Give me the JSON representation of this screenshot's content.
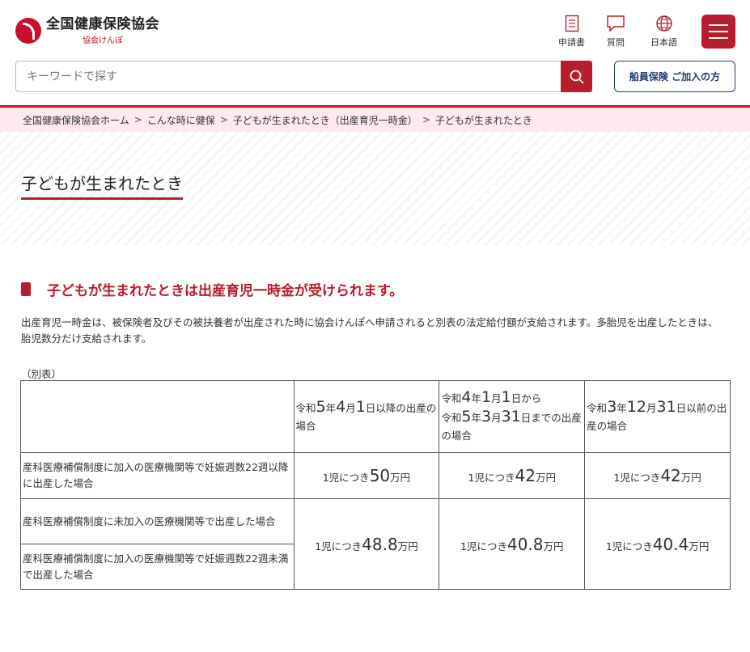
{
  "header": {
    "logo_main": "全国健康保険協会",
    "logo_sub": "協会けんぽ",
    "nav": [
      {
        "label": "申請書",
        "icon": "document-icon"
      },
      {
        "label": "質問",
        "icon": "speech-bubble-icon"
      },
      {
        "label": "日本語",
        "icon": "globe-icon"
      }
    ],
    "menu_icon": "hamburger-menu-icon",
    "search_placeholder": "キーワードで探す",
    "seaman_button": "船員保険 ご加入の方",
    "accent_color": "#b91c2c"
  },
  "breadcrumb": [
    "全国健康保険協会ホーム",
    "こんな時に健保",
    "子どもが生まれたとき（出産育児一時金）",
    "子どもが生まれたとき"
  ],
  "page_title": "子どもが生まれたとき",
  "section": {
    "title": "子どもが生まれたときは出産育児一時金が受けられます。",
    "lead": "出産育児一時金は、被保険者及びその被扶養者が出産された時に協会けんぽへ申請されると別表の法定給付額が支給されます。多胎児を出産したときは、胎児数分だけ支給されます。",
    "table_caption": "（別表）"
  },
  "table": {
    "col1": {
      "a": "令和",
      "b": "5",
      "c": "年",
      "d": "4",
      "e": "月",
      "f": "1",
      "g": "日以降の出産の場合"
    },
    "col2": {
      "a": "令和",
      "b": "4",
      "c": "年",
      "d": "1",
      "e": "月",
      "f": "1",
      "g": "日から",
      "h": "令和",
      "i": "5",
      "j": "年",
      "k": "3",
      "l": "月",
      "m": "31",
      "n": "日までの出産の場合"
    },
    "col3": {
      "a": "令和",
      "b": "3",
      "c": "年",
      "d": "12",
      "e": "月",
      "f": "31",
      "g": "日以前の出産の場合"
    },
    "row1_label": "産科医療補償制度に加入の医療機関等で妊娠週数22週以降に出産した場合",
    "row2_label": "産科医療補償制度に未加入の医療機関等で出産した場合",
    "row3_label": "産科医療補償制度に加入の医療機関等で妊娠週数22週未満で出産した場合",
    "prefix": "1児につき",
    "unit": "万円",
    "row1_values": [
      "50",
      "42",
      "42"
    ],
    "row23_values": [
      "48.8",
      "40.8",
      "40.4"
    ]
  }
}
